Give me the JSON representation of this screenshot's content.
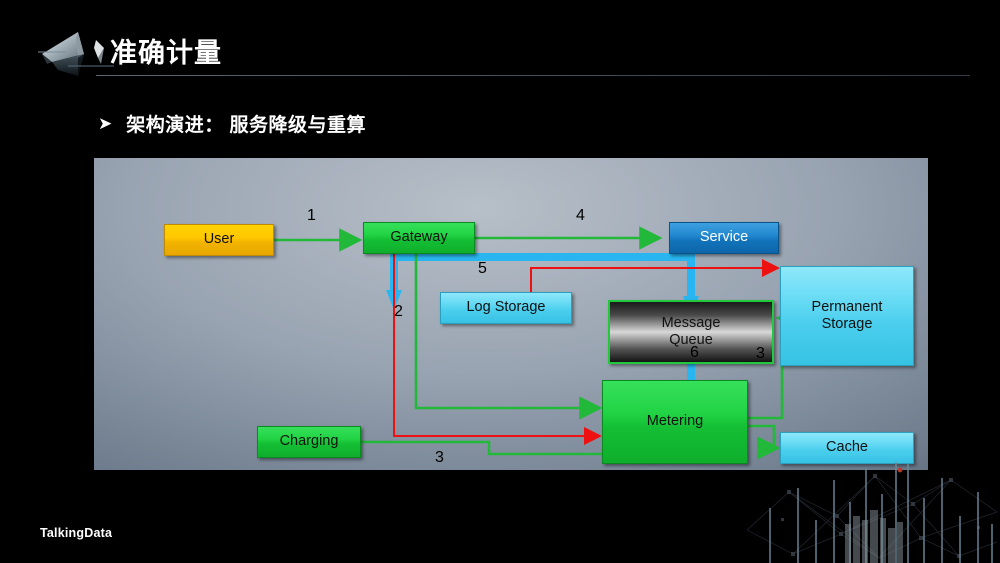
{
  "header": {
    "title": "准确计量",
    "logo_icon": "paper-plane-logo"
  },
  "subtitle": {
    "bullet_icon": "triangle-right-bullet",
    "text": "架构演进： 服务降级与重算"
  },
  "footer": {
    "brand": "TalkingData",
    "decoration_icon": "network-skyline-decoration"
  },
  "diagram": {
    "nodes": [
      {
        "id": "user",
        "label": "User",
        "style": "yellow"
      },
      {
        "id": "gateway",
        "label": "Gateway",
        "style": "green"
      },
      {
        "id": "service",
        "label": "Service",
        "style": "blue"
      },
      {
        "id": "log",
        "label": "Log Storage",
        "style": "cyan"
      },
      {
        "id": "mq",
        "label": "Message\nQueue",
        "style": "black-gradient",
        "label_line1": "Message",
        "label_line2": "Queue"
      },
      {
        "id": "permanent",
        "label": "Permanent Storage",
        "style": "cyan",
        "label_line1": "Permanent",
        "label_line2": "Storage"
      },
      {
        "id": "metering",
        "label": "Metering",
        "style": "green"
      },
      {
        "id": "charging",
        "label": "Charging",
        "style": "green"
      },
      {
        "id": "cache",
        "label": "Cache",
        "style": "cyan"
      }
    ],
    "edge_labels": {
      "e1": "1",
      "e2": "2",
      "e3_storage": "3",
      "e3_charging": "3",
      "e4": "4",
      "e5": "5",
      "e6": "6"
    },
    "edge_colors": {
      "green": "#22b83a",
      "red": "#ee1111",
      "cyan": "#29b6f0"
    }
  }
}
